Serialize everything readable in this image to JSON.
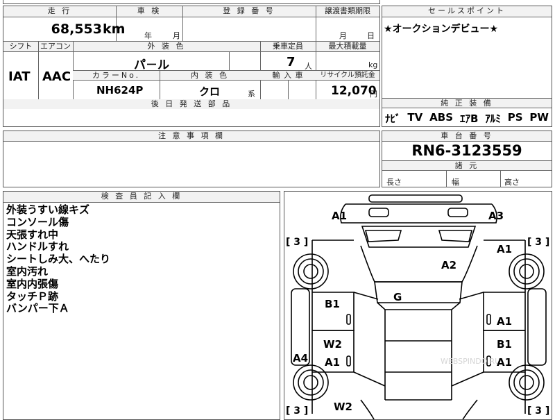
{
  "top": {
    "mileage_label": "走 行",
    "mileage_value": "68,553",
    "mileage_unit": "km",
    "inspection_label": "車 検",
    "year_unit": "年",
    "month_unit": "月",
    "registration_label": "登 録 番 号",
    "transfer_label": "譲渡書類期限",
    "transfer_month": "月",
    "transfer_day": "日",
    "sales_point_label": "セールスポイント",
    "sales_point_text": "★オークションデビュー★"
  },
  "mid": {
    "shift_label": "シフト",
    "shift_value": "IAT",
    "ac_label": "エアコン",
    "ac_value": "AAC",
    "exterior_color_label": "外 装 色",
    "exterior_color_value": "パ－ル",
    "capacity_label": "乗車定員",
    "capacity_value": "7",
    "capacity_unit": "人",
    "max_load_label": "最大積載量",
    "max_load_unit": "kg",
    "color_no_label": "カラーNo.",
    "color_no_value": "NH624P",
    "interior_color_label": "内 装 色",
    "interior_color_value": "クロ",
    "interior_suffix": "系",
    "import_label": "輸 入 車",
    "recycle_label": "リサイクル預託金",
    "recycle_value": "12,070",
    "recycle_unit": "円",
    "rear_parts_label": "後 日 発 送 部 品",
    "equipment_label": "純 正 装 備",
    "equipment_items": [
      "ﾅﾋﾞ",
      "TV",
      "ABS",
      "ｴｱB",
      "ｱﾙﾐ",
      "PS",
      "PW"
    ]
  },
  "caution": {
    "label": "注 意 事 項 欄"
  },
  "chassis": {
    "label": "車 台 番 号",
    "value": "RN6-3123559",
    "dims_label": "諸 元",
    "length_label": "長さ",
    "width_label": "幅",
    "height_label": "高さ"
  },
  "inspector": {
    "label": "検 査 員 記 入 欄",
    "notes": [
      "外装うすい線キズ",
      "コンソール傷",
      "天張すれ中",
      "ハンドルすれ",
      "シートしみ大、へたり",
      "室内汚れ",
      "室内内張傷",
      "タッチＰ跡",
      "バンパー下Ａ"
    ]
  },
  "diagram": {
    "watermark": "WEBSPINDO.RU",
    "marks": [
      {
        "id": "a1-front-left",
        "text": "A1"
      },
      {
        "id": "a3-front-right",
        "text": "A3"
      },
      {
        "id": "a1-right-fender",
        "text": "A1"
      },
      {
        "id": "a2-hood",
        "text": "A2"
      },
      {
        "id": "g-windshield",
        "text": "G"
      },
      {
        "id": "b1-left-front-door",
        "text": "B1"
      },
      {
        "id": "a1-right-front-door",
        "text": "A1"
      },
      {
        "id": "w2-left-rear-door",
        "text": "W2"
      },
      {
        "id": "a1-left-rear-door",
        "text": "A1"
      },
      {
        "id": "b1-right-rear-door",
        "text": "B1"
      },
      {
        "id": "a1-right-rear-door",
        "text": "A1"
      },
      {
        "id": "a4-left-side",
        "text": "A4"
      },
      {
        "id": "w2-left-quarter",
        "text": "W2"
      }
    ],
    "tire_marks": [
      {
        "id": "tire-front-left",
        "text": "[ 3 ]"
      },
      {
        "id": "tire-front-right",
        "text": "[ 3 ]"
      },
      {
        "id": "tire-rear-left",
        "text": "[ 3 ]"
      },
      {
        "id": "tire-rear-right",
        "text": "[ 3 ]"
      }
    ]
  }
}
